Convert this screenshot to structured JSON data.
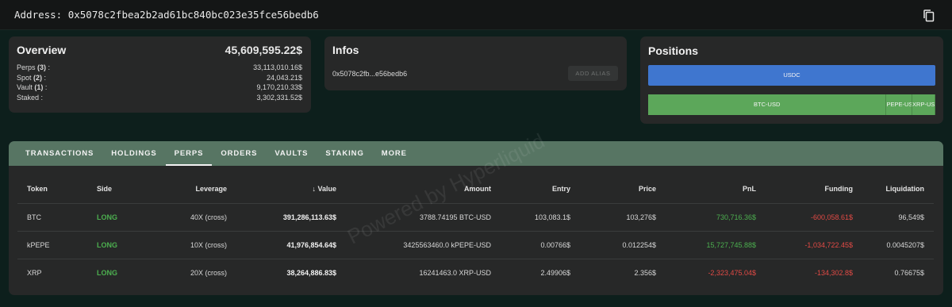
{
  "address_bar": {
    "text": "Address: 0x5078c2fbea2b2ad61bc840bc023e35fce56bedb6",
    "copy_icon": "copy-icon"
  },
  "overview": {
    "title": "Overview",
    "total": "45,609,595.22$",
    "rows": [
      {
        "label": "Perps",
        "count": "(3)",
        "suffix": ":",
        "value": "33,113,010.16$"
      },
      {
        "label": "Spot",
        "count": "(2)",
        "suffix": ":",
        "value": "24,043.21$"
      },
      {
        "label": "Vault",
        "count": "(1)",
        "suffix": ":",
        "value": "9,170,210.33$"
      },
      {
        "label": "Staked",
        "count": "",
        "suffix": ":",
        "value": "3,302,331.52$"
      }
    ]
  },
  "infos": {
    "title": "Infos",
    "address_short": "0x5078c2fb...e56bedb6",
    "add_alias_label": "ADD ALIAS"
  },
  "positions": {
    "title": "Positions",
    "spot": [
      {
        "label": "USDC",
        "share": 1.0,
        "color": "#3f76cf"
      }
    ],
    "perps": [
      {
        "label": "BTC-USD",
        "share": 0.83,
        "color": "#5ca75a"
      },
      {
        "label": "PEPE-USD",
        "share": 0.09,
        "color": "#5ca75a"
      },
      {
        "label": "XRP-USD",
        "share": 0.08,
        "color": "#5ca75a"
      }
    ]
  },
  "tabs": [
    "TRANSACTIONS",
    "HOLDINGS",
    "PERPS",
    "ORDERS",
    "VAULTS",
    "STAKING",
    "MORE"
  ],
  "active_tab": "PERPS",
  "table": {
    "headers": {
      "token": "Token",
      "side": "Side",
      "leverage": "Leverage",
      "value": "Value",
      "amount": "Amount",
      "entry": "Entry",
      "price": "Price",
      "pnl": "PnL",
      "funding": "Funding",
      "liquidation": "Liquidation"
    },
    "sort_icon": "arrow-down-icon",
    "rows": [
      {
        "token": "BTC",
        "side": "LONG",
        "leverage": "40X (cross)",
        "value": "391,286,113.63$",
        "amount": "3788.74195 BTC-USD",
        "entry": "103,083.1$",
        "price": "103,276$",
        "pnl": "730,716.36$",
        "funding": "-600,058.61$",
        "liquidation": "96,549$"
      },
      {
        "token": "kPEPE",
        "side": "LONG",
        "leverage": "10X (cross)",
        "value": "41,976,854.64$",
        "amount": "3425563460.0 kPEPE-USD",
        "entry": "0.00766$",
        "price": "0.012254$",
        "pnl": "15,727,745.88$",
        "funding": "-1,034,722.45$",
        "liquidation": "0.0045207$"
      },
      {
        "token": "XRP",
        "side": "LONG",
        "leverage": "20X (cross)",
        "value": "38,264,886.83$",
        "amount": "16241463.0 XRP-USD",
        "entry": "2.49906$",
        "price": "2.356$",
        "pnl": "-2,323,475.04$",
        "funding": "-134,302.8$",
        "liquidation": "0.76675$"
      }
    ]
  },
  "watermark": "Powered by Hyperliquid",
  "colors": {
    "long": "#4caf4f",
    "negative": "#e24a45",
    "tabs_bg": "#577563"
  }
}
